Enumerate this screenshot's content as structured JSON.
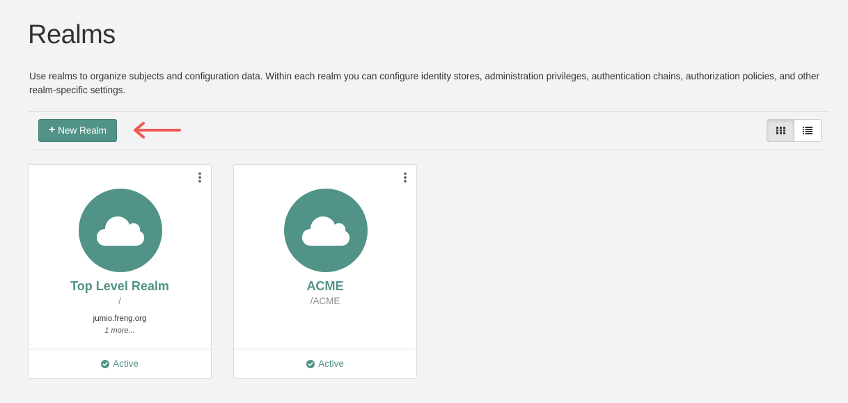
{
  "page": {
    "title": "Realms",
    "description": "Use realms to organize subjects and configuration data. Within each realm you can configure identity stores, administration privileges, authentication chains, authorization policies, and other realm-specific settings."
  },
  "toolbar": {
    "new_realm_label": "New Realm",
    "new_realm_icon": "plus-icon",
    "view_modes": [
      "grid-icon",
      "list-icon"
    ],
    "active_view": "grid"
  },
  "realms": [
    {
      "name": "Top Level Realm",
      "path": "/",
      "hostname": "jumio.freng.org",
      "more": "1 more...",
      "status": "Active",
      "icon": "cloud-icon"
    },
    {
      "name": "ACME",
      "path": "/ACME",
      "status": "Active",
      "icon": "cloud-icon"
    }
  ],
  "colors": {
    "accent": "#519387",
    "annotation_arrow": "#f05a55",
    "background": "#f3f3f3"
  }
}
